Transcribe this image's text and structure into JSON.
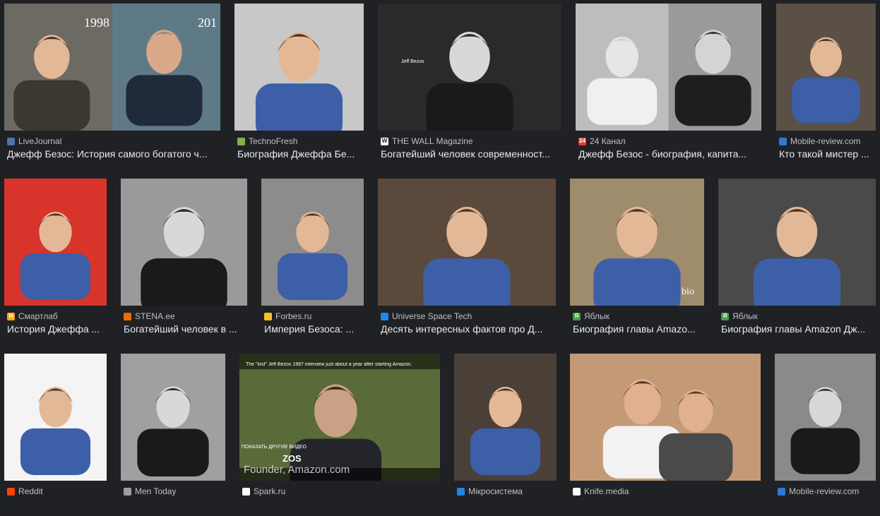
{
  "results": [
    {
      "source": "LiveJournal",
      "title": "Джефф Безос: История самого богатого ч...",
      "favicon_color": "#4a76a8",
      "favicon_glyph": "",
      "bg": "#6d6a64"
    },
    {
      "source": "TechnoFresh",
      "title": "Биография Джеффа Бе...",
      "favicon_color": "#7cb342",
      "favicon_glyph": "",
      "bg": "#c8c8c8"
    },
    {
      "source": "THE WALL Magazine",
      "title": "Богатейший человек современност...",
      "favicon_color": "#ffffff",
      "favicon_glyph": "W",
      "bg": "#2a2a2a"
    },
    {
      "source": "24 Канал",
      "title": "Джефф Безос - биография, капита...",
      "favicon_color": "#e53935",
      "favicon_glyph": "24",
      "bg": "#bdbdbd"
    },
    {
      "source": "Mobile-review.com",
      "title": "Кто такой мистер ...",
      "favicon_color": "#2b7bd6",
      "favicon_glyph": "",
      "bg": "#5a5046"
    },
    {
      "source": "Смартлаб",
      "title": "История Джеффа ...",
      "favicon_color": "#f9a825",
      "favicon_glyph": "H",
      "bg": "#d9342b"
    },
    {
      "source": "STENA.ee",
      "title": "Богатейший человек в ...",
      "favicon_color": "#ef6c00",
      "favicon_glyph": "",
      "bg": "#9a9a9a"
    },
    {
      "source": "Forbes.ru",
      "title": "Империя Безоса: ...",
      "favicon_color": "#fbc02d",
      "favicon_glyph": "",
      "bg": "#8c8c8c"
    },
    {
      "source": "Universe Space Tech",
      "title": "Десять интересных фактов про Д...",
      "favicon_color": "#1e88e5",
      "favicon_glyph": "",
      "bg": "#5b4a3c"
    },
    {
      "source": "Яблык",
      "title": "Биография главы Amazo...",
      "favicon_color": "#43a047",
      "favicon_glyph": "Я",
      "bg": "#9e8c6c"
    },
    {
      "source": "Яблык",
      "title": "Биография главы Amazon Дж...",
      "favicon_color": "#43a047",
      "favicon_glyph": "Я",
      "bg": "#4a4a4a"
    },
    {
      "source": "Reddit",
      "title": "",
      "favicon_color": "#ff4500",
      "favicon_glyph": "",
      "bg": "#f4f4f4"
    },
    {
      "source": "Men Today",
      "title": "",
      "favicon_color": "#9e9e9e",
      "favicon_glyph": "",
      "bg": "#a0a0a0"
    },
    {
      "source": "Spark.ru",
      "title": "",
      "favicon_color": "#ffffff",
      "favicon_glyph": "",
      "bg": "#5a6b3a"
    },
    {
      "source": "Мікросистема",
      "title": "",
      "favicon_color": "#1e88e5",
      "favicon_glyph": "",
      "bg": "#4a4038"
    },
    {
      "source": "Knife.media",
      "title": "",
      "favicon_color": "#ffffff",
      "favicon_glyph": "",
      "bg": "#c49a76"
    },
    {
      "source": "Mobile-review.com",
      "title": "",
      "favicon_color": "#2b7bd6",
      "favicon_glyph": "",
      "bg": "#8a8a8a"
    }
  ],
  "overlays": {
    "year_left": "1998",
    "year_right": "201",
    "wall_label": "Jeff Bezos",
    "stiker": "bio",
    "video_top": "The \"lost\" Jeff Bezos 1997 interview just about a year after starting Amazon.",
    "video_name": "ZOS",
    "video_caption": "Founder, Amazon.com",
    "video_show": "ПОКАЗАТЬ ДРУГИЕ ВИДЕО"
  }
}
